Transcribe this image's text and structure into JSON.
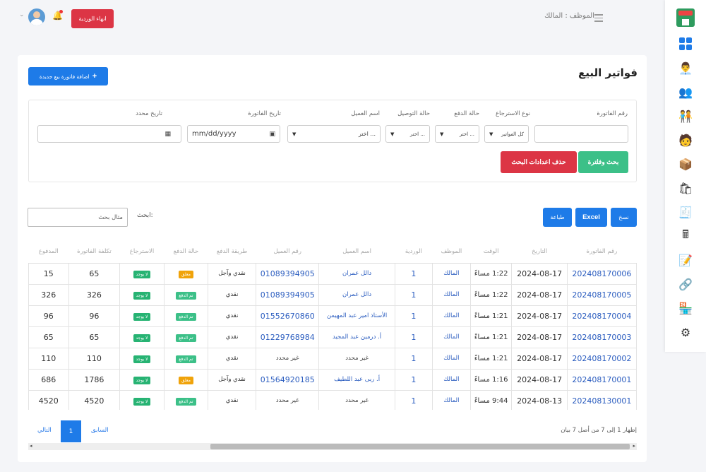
{
  "header": {
    "end_shift_label": "انهاء الوردية",
    "user_label": "الموظف : المالك"
  },
  "sidebar": {
    "icons": [
      "store-logo-icon",
      "dashboard-icon",
      "employee-icon",
      "team-icon",
      "customers-icon",
      "user-icon",
      "boxes-icon",
      "products-icon",
      "invoice-icon",
      "calculator-icon",
      "report-icon",
      "links-icon",
      "warehouse-icon",
      "settings-icon"
    ]
  },
  "page": {
    "title": "فواتير البيع",
    "add_button": "اضافة فاتورة بيع جديدة"
  },
  "filters": {
    "invoice_number_label": "رقم الفاتورة",
    "return_type_label": "نوع الاسترجاع",
    "return_type_value": "كل الفواتير",
    "payment_status_label": "حالة الدفع",
    "payment_status_value": "اختر ...",
    "delivery_status_label": "حالة التوصيل",
    "delivery_status_value": "اختر ...",
    "customer_name_label": "اسم العميل",
    "customer_name_value": "اختر ...",
    "invoice_date_label": "تاريخ الفاتورة",
    "invoice_date_value": "mm/dd/yyyy",
    "specific_date_label": "تاريخ محدد",
    "search_button": "بحث وفلترة",
    "reset_button": "حذف اعدادات البحث"
  },
  "toolbar": {
    "copy": "نسخ",
    "excel": "Excel",
    "print": "طباعة",
    "search_label": "ابحث:",
    "search_placeholder": "مثال بحث"
  },
  "table": {
    "headers": [
      "رقم الفاتورة",
      "التاريخ",
      "الوقت",
      "الموظف",
      "الوردية",
      "اسم العميل",
      "رقم العميل",
      "طريقة الدفع",
      "حالة الدفع",
      "الاسترجاع",
      "تكلفة الفاتورة",
      "المدفوع"
    ],
    "rows": [
      {
        "num": "202408170006",
        "date": "2024-08-17",
        "time": "1:22 مساءً",
        "emp": "المالك",
        "shift": "1",
        "cust": "دالل عمران",
        "phone": "01089394905",
        "method": "نقدي وآجل",
        "pay": "معلق",
        "ret": "لا يوجد",
        "cost": "65",
        "paid": "15"
      },
      {
        "num": "202408170005",
        "date": "2024-08-17",
        "time": "1:22 مساءً",
        "emp": "المالك",
        "shift": "1",
        "cust": "دالل عمران",
        "phone": "01089394905",
        "method": "نقدي",
        "pay": "تم الدفع",
        "ret": "لا يوجد",
        "cost": "326",
        "paid": "326"
      },
      {
        "num": "202408170004",
        "date": "2024-08-17",
        "time": "1:21 مساءً",
        "emp": "المالك",
        "shift": "1",
        "cust": "الأستاذ امير عبد المهيمن",
        "phone": "01552670860",
        "method": "نقدي",
        "pay": "تم الدفع",
        "ret": "لا يوجد",
        "cost": "96",
        "paid": "96"
      },
      {
        "num": "202408170003",
        "date": "2024-08-17",
        "time": "1:21 مساءً",
        "emp": "المالك",
        "shift": "1",
        "cust": "أ. درمين عبد المجيد",
        "phone": "01229768984",
        "method": "نقدي",
        "pay": "تم الدفع",
        "ret": "لا يوجد",
        "cost": "65",
        "paid": "65"
      },
      {
        "num": "202408170002",
        "date": "2024-08-17",
        "time": "1:21 مساءً",
        "emp": "المالك",
        "shift": "1",
        "cust": "غير محدد",
        "phone": "غير محدد",
        "method": "نقدي",
        "pay": "تم الدفع",
        "ret": "لا يوجد",
        "cost": "110",
        "paid": "110"
      },
      {
        "num": "202408170001",
        "date": "2024-08-17",
        "time": "1:16 مساءً",
        "emp": "المالك",
        "shift": "1",
        "cust": "أ. ربى عبد اللطيف",
        "phone": "01564920185",
        "method": "نقدي وآجل",
        "pay": "معلق",
        "ret": "لا يوجد",
        "cost": "1786",
        "paid": "686"
      },
      {
        "num": "202408130001",
        "date": "2024-08-13",
        "time": "9:44 مساءً",
        "emp": "المالك",
        "shift": "1",
        "cust": "غير محدد",
        "phone": "غير محدد",
        "method": "نقدي",
        "pay": "تم الدفع",
        "ret": "لا يوجد",
        "cost": "4520",
        "paid": "4520"
      }
    ]
  },
  "pagination": {
    "info": "إظهار 1 إلى 7 من أصل 7 بيان",
    "prev": "السابق",
    "page": "1",
    "next": "التالي"
  },
  "colors": {
    "primary": "#1e7be8",
    "danger": "#dc3545",
    "success": "#3cc088",
    "pending": "#f0a30a",
    "paid": "#3cc088",
    "none": "#27b373"
  }
}
